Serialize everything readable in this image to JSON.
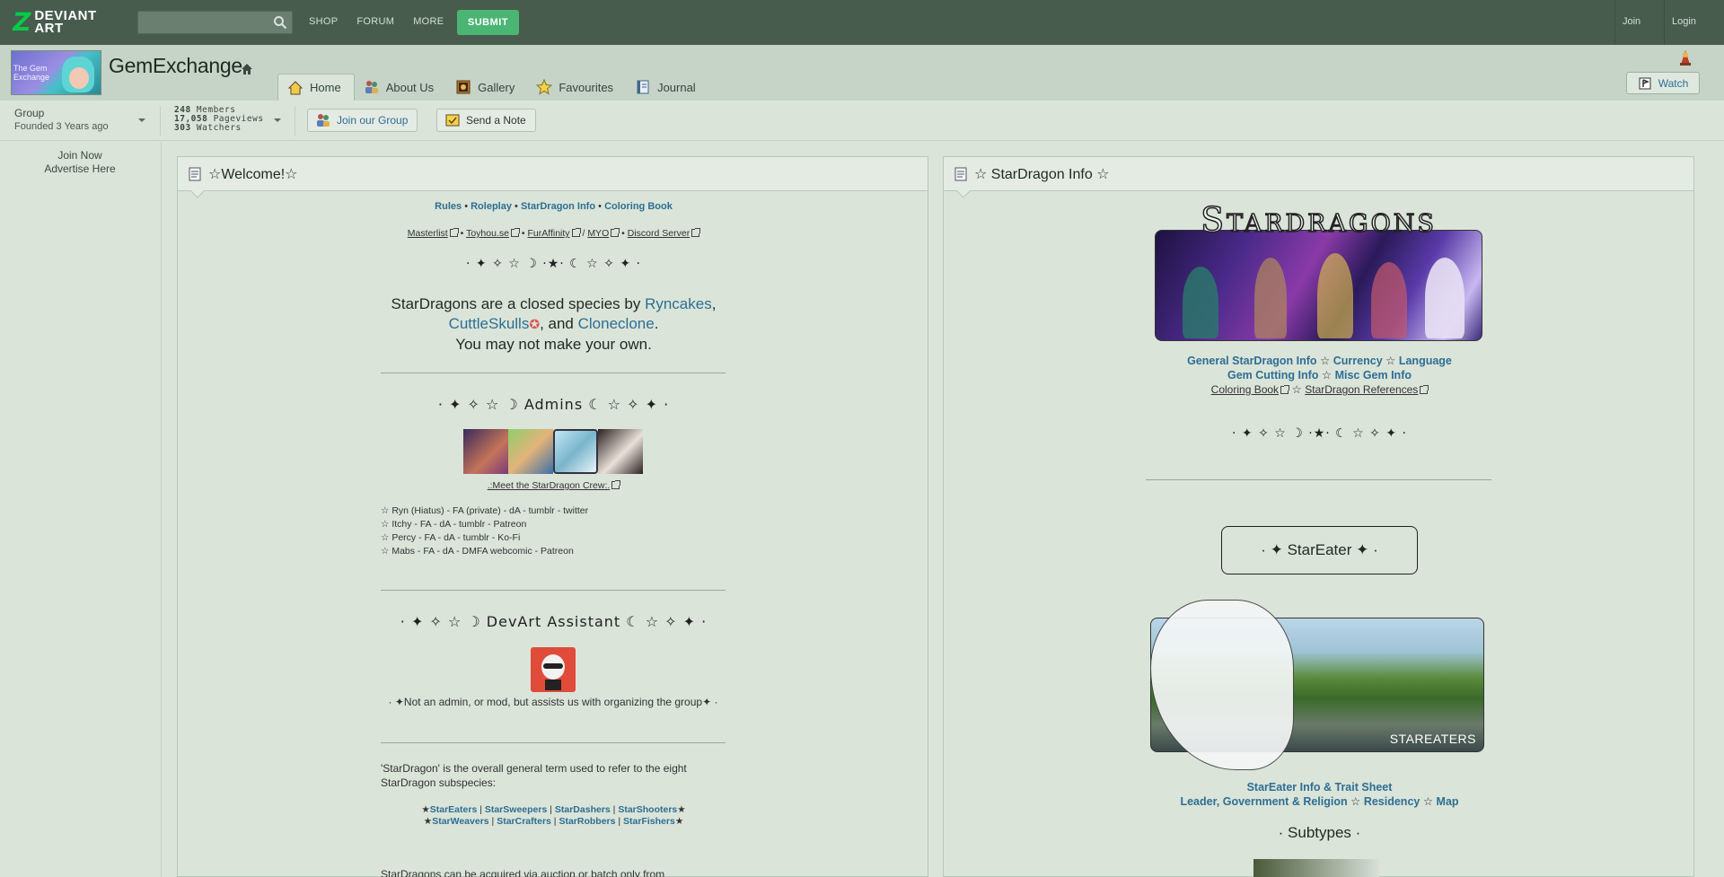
{
  "topnav": {
    "logo_text": "DEVIANT ART",
    "links": [
      "SHOP",
      "FORUM",
      "MORE"
    ],
    "submit": "SUBMIT",
    "join": "Join",
    "login": "Login"
  },
  "group": {
    "avatar_caption": "The Gem Exchange",
    "name": "GemExchange",
    "tabs": [
      "Home",
      "About Us",
      "Gallery",
      "Favourites",
      "Journal"
    ],
    "watch": "Watch",
    "type": "Group",
    "founded": "Founded 3 Years ago",
    "stats": {
      "members_value": "248",
      "members_label": "Members",
      "pageviews_value": "17,058",
      "pageviews_label": "Pageviews",
      "watchers_value": "303",
      "watchers_label": "Watchers"
    },
    "join_button": "Join our Group",
    "note_button": "Send a Note"
  },
  "sidebar": {
    "join_now": "Join Now",
    "advertise": "Advertise Here"
  },
  "welcome": {
    "title": "☆Welcome!☆",
    "links_rules": "Rules",
    "links_roleplay": "Roleplay",
    "links_info": "StarDragon Info",
    "links_coloring": "Coloring Book",
    "ext_masterlist": "Masterlist",
    "ext_toyhouse": "Toyhou.se",
    "ext_furaffinity": "FurAffinity",
    "ext_myo": "MYO",
    "ext_discord": "Discord Server",
    "divider": "· ✦ ✧ ☆ ☽ ·★· ☾ ☆ ✧ ✦ ·",
    "intro_1": "StarDragons are a closed species by",
    "intro_ryncakes": "Ryncakes",
    "intro_cuttle": "CuttleSkulls",
    "intro_and": ", and",
    "intro_clone": "Cloneclone",
    "intro_2": "You may not make your own.",
    "admins_heading": "· ✦ ✧ ☆ ☽ Admins ☾ ☆ ✧ ✦ ·",
    "meet_crew": ".:Meet the StarDragon Crew:.",
    "admin_rows": [
      "☆ Ryn (Hiatus) - FA (private) - dA - tumblr - twitter",
      "☆ Itchy - FA - dA - tumblr - Patreon",
      "☆ Percy - FA - dA - tumblr - Ko-Fi",
      "☆ Mabs - FA - dA - DMFA webcomic - Patreon"
    ],
    "assistant_heading": "· ✦ ✧ ☆ ☽ DevArt Assistant ☾ ☆ ✧ ✦ ·",
    "assistant_note": "· ✦Not an admin, or mod, but assists us with organizing the group✦ ·",
    "term_text": "'StarDragon' is the overall general term used to refer to the eight StarDragon subspecies:",
    "subspecies_1": [
      "StarEaters",
      "StarSweepers",
      "StarDashers",
      "StarShooters"
    ],
    "subspecies_2": [
      "StarWeavers",
      "StarCrafters",
      "StarRobbers",
      "StarFishers"
    ],
    "acquire_text": "StarDragons can be acquired via auction or batch only from"
  },
  "info": {
    "title": "☆ StarDragon Info ☆",
    "banner_title": "Stardragons",
    "links_row1": [
      "General StarDragon Info",
      "Currency",
      "Language"
    ],
    "links_row2": [
      "Gem Cutting Info",
      "Misc Gem Info"
    ],
    "links_row3": [
      "Coloring Book",
      "StarDragon References"
    ],
    "divider": "· ✦ ✧ ☆ ☽ ·★· ☾ ☆ ✧ ✦ ·",
    "stareater_heading": "· ✦ StarEater ✦ ·",
    "stareater_banner": "STAREATERS",
    "stareater_row1": "StarEater Info & Trait Sheet",
    "stareater_row2": [
      "Leader, Government & Religion",
      "Residency",
      "Map"
    ],
    "subtypes": "· Subtypes ·"
  },
  "colors": {
    "topbar": "#475c4d",
    "header": "#c5d4c6",
    "page": "#dae4d9",
    "accent": "#4bb574",
    "link": "#2e6e93"
  }
}
